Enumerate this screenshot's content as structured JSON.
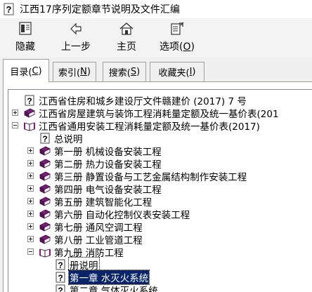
{
  "window": {
    "title": "江西17序列定额章节说明及文件汇编"
  },
  "toolbar": {
    "hide": {
      "label": "隐藏",
      "icon": "hide-icon"
    },
    "back": {
      "label": "上一步",
      "icon": "back-arrow-icon"
    },
    "home": {
      "label": "主页",
      "icon": "home-icon"
    },
    "options": {
      "label_prefix": "选项(",
      "label_key": "O",
      "label_suffix": ")",
      "icon": "options-icon"
    }
  },
  "tabs": [
    {
      "prefix": "目录(",
      "key": "C",
      "suffix": ")",
      "active": true
    },
    {
      "prefix": "索引(",
      "key": "N",
      "suffix": ")",
      "active": false
    },
    {
      "prefix": "搜索(",
      "key": "S",
      "suffix": ")",
      "active": false
    },
    {
      "prefix": "收藏夹(",
      "key": "I",
      "suffix": ")",
      "active": false
    }
  ],
  "tree": {
    "items": [
      {
        "label": "江西省住房和城乡建设厅文件赣建价 (2017) 7 号",
        "icon": "help-page-icon",
        "expander": "none",
        "level": 0
      },
      {
        "label": "江西省房屋建筑与装饰工程消耗量定额及统一基价表(201",
        "icon": "closed-book-icon",
        "expander": "plus",
        "level": 0
      },
      {
        "label": "江西省通用安装工程消耗量定额及统一基价表(2017)",
        "icon": "open-book-icon",
        "expander": "minus",
        "level": 0
      },
      {
        "label": "总说明",
        "icon": "help-page-icon",
        "expander": "none",
        "level": 1
      },
      {
        "label": "第一册  机械设备安装工程",
        "icon": "closed-book-icon",
        "expander": "plus",
        "level": 1
      },
      {
        "label": "第二册  热力设备安装工程",
        "icon": "closed-book-icon",
        "expander": "plus",
        "level": 1
      },
      {
        "label": "第三册  静置设备与工艺金属结构制作安装工程",
        "icon": "closed-book-icon",
        "expander": "plus",
        "level": 1
      },
      {
        "label": "第四册  电气设备安装工程",
        "icon": "closed-book-icon",
        "expander": "plus",
        "level": 1
      },
      {
        "label": "第五册  建筑智能化工程",
        "icon": "closed-book-icon",
        "expander": "plus",
        "level": 1
      },
      {
        "label": "第六册  自动化控制仪表安装工程",
        "icon": "closed-book-icon",
        "expander": "plus",
        "level": 1
      },
      {
        "label": "第七册  通风空调工程",
        "icon": "closed-book-icon",
        "expander": "plus",
        "level": 1
      },
      {
        "label": "第八册  工业管道工程",
        "icon": "closed-book-icon",
        "expander": "plus",
        "level": 1
      },
      {
        "label": "第九册  消防工程",
        "icon": "open-book-icon",
        "expander": "minus",
        "level": 1
      },
      {
        "label": "册说明",
        "icon": "help-page-icon",
        "expander": "none",
        "level": 2,
        "state": "focused"
      },
      {
        "label": "第一章  水灭火系统",
        "icon": "help-page-icon",
        "expander": "none",
        "level": 2,
        "state": "selected"
      },
      {
        "label": "第二章  气体灭火系统",
        "icon": "help-page-icon",
        "expander": "none",
        "level": 2
      }
    ]
  },
  "colors": {
    "selection": "#0a246a",
    "book": "#7a1f7a",
    "toolbar_bg": "#f3f3f3",
    "tab_bg": "#f0f0f0"
  }
}
